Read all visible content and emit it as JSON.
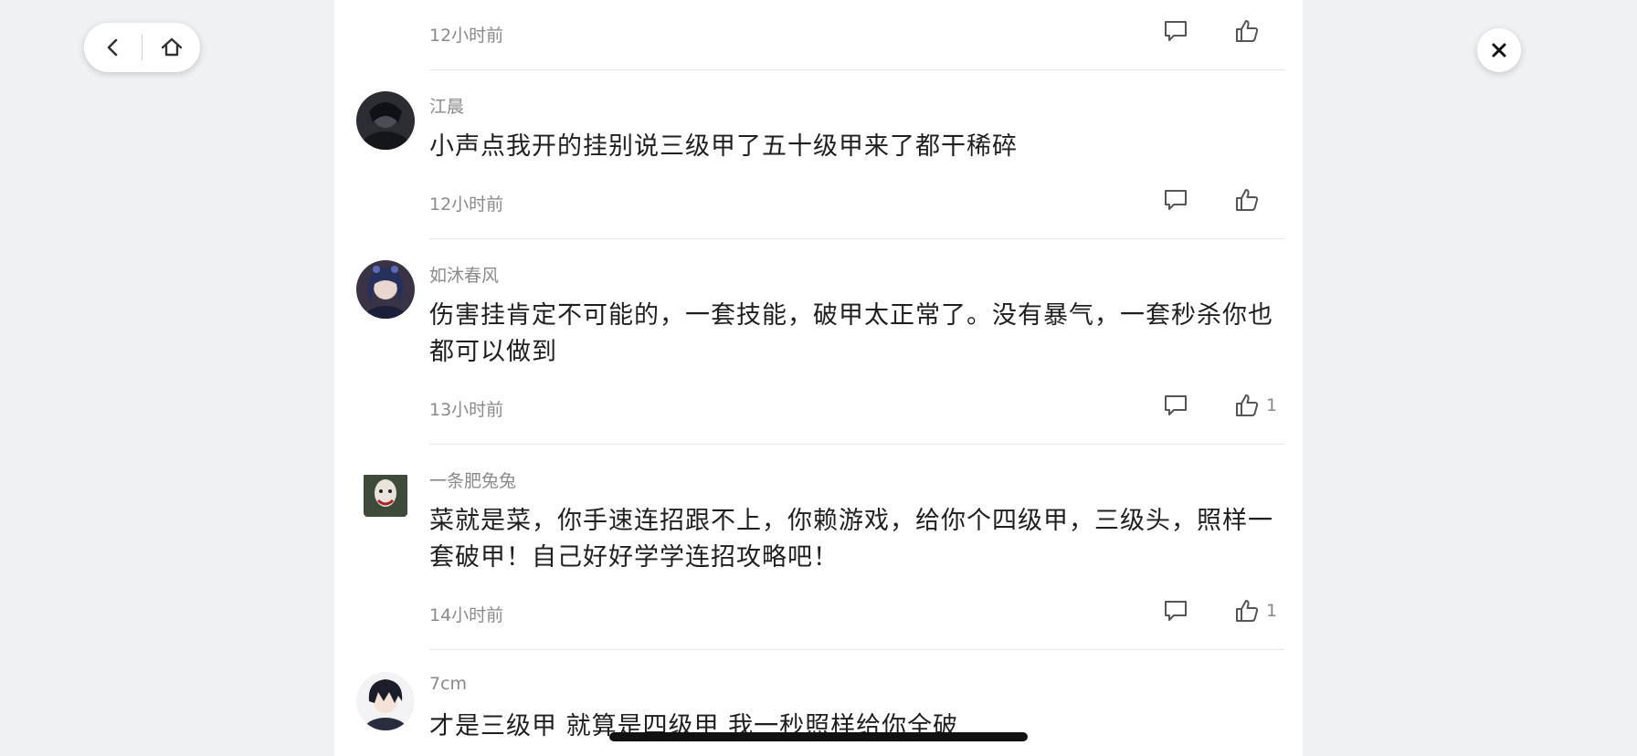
{
  "nav": {
    "back_icon": "chevron-left-icon",
    "home_icon": "home-icon"
  },
  "close_icon": "close-icon",
  "comments": [
    {
      "username": "",
      "text": "",
      "time": "12小时前",
      "likes": ""
    },
    {
      "username": "江晨",
      "text": "小声点我开的挂别说三级甲了五十级甲来了都干稀碎",
      "time": "12小时前",
      "likes": ""
    },
    {
      "username": "如沐春风",
      "text": "伤害挂肯定不可能的，一套技能，破甲太正常了。没有暴气，一套秒杀你也都可以做到",
      "time": "13小时前",
      "likes": "1"
    },
    {
      "username": "一条肥兔兔",
      "text": "菜就是菜，你手速连招跟不上，你赖游戏，给你个四级甲，三级头，照样一套破甲！自己好好学学连招攻略吧！",
      "time": "14小时前",
      "likes": "1"
    },
    {
      "username": "7cm",
      "text": "才是三级甲 就算是四级甲 我一秒照样给你全破",
      "time": "",
      "likes": ""
    }
  ],
  "colors": {
    "background": "#f0f1f3",
    "panel": "#ffffff",
    "text": "#1f1f1f",
    "muted": "#8a8a8a"
  }
}
